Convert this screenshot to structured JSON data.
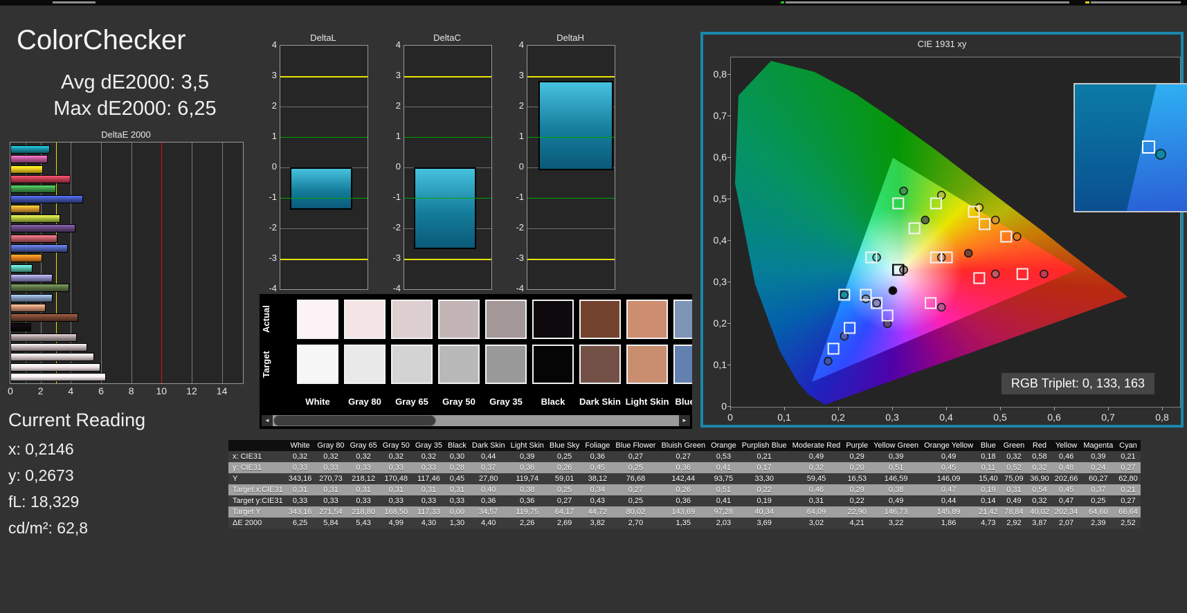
{
  "summary": {
    "title": "ColorChecker",
    "avg": "Avg dE2000: 3,5",
    "max": "Max dE2000: 6,25"
  },
  "deltae_chart": {
    "title": "DeltaE 2000",
    "x_ticks": [
      0,
      2,
      4,
      6,
      8,
      10,
      12,
      14
    ],
    "x_max": 15.3,
    "guide_colors": {
      "green": "#00a400",
      "yellow": "#e4e400",
      "red": "#e01010"
    },
    "guides": {
      "green": 1,
      "yellow": 3,
      "red": 10
    }
  },
  "delta_bars": {
    "titles": [
      "DeltaL",
      "DeltaC",
      "DeltaH"
    ],
    "values": [
      -1.3,
      -2.6,
      2.85
    ],
    "y_ticks": [
      4,
      3,
      2,
      1,
      0,
      -1,
      -2,
      -3,
      -4
    ],
    "green_guides": [
      1,
      -1
    ],
    "yellow_guides": [
      3,
      -3
    ]
  },
  "swatch_panel": {
    "row_labels": [
      "Actual",
      "Target"
    ],
    "scrollbar": {
      "left_arrow": "◄",
      "right_arrow": "►"
    }
  },
  "cie": {
    "title": "CIE 1931 xy",
    "rgb_triplet": "RGB Triplet: 0, 133, 163",
    "x_ticks": [
      "0",
      "0,1",
      "0,2",
      "0,3",
      "0,4",
      "0,5",
      "0,6",
      "0,7",
      "0,8"
    ],
    "y_ticks": [
      "0",
      "0,1",
      "0,2",
      "0,3",
      "0,4",
      "0,5",
      "0,6",
      "0,7",
      "0,8"
    ],
    "accent": "#1b87ab"
  },
  "current_reading": {
    "title": "Current Reading",
    "lines": [
      "x: 0,2146",
      "y: 0,2673",
      "fL: 18,329",
      "cd/m²: 62,8"
    ]
  },
  "table": {
    "row_labels": [
      "x: CIE31",
      "y: CIE31",
      "Y",
      "Target x:CIE31",
      "Target y:CIE31",
      "Target Y",
      "ΔE 2000"
    ]
  },
  "patches": [
    {
      "name": "White",
      "actual_color": "#fdf3f6",
      "target_color": "#f7f7f7",
      "x": "0,32",
      "y": "0,33",
      "Y": "343,16",
      "tx": "0,31",
      "ty": "0,33",
      "tY": "343,16",
      "dE": "6,25"
    },
    {
      "name": "Gray 80",
      "actual_color": "#f3e5e6",
      "target_color": "#e9e9e9",
      "x": "0,32",
      "y": "0,33",
      "Y": "270,73",
      "tx": "0,31",
      "ty": "0,33",
      "tY": "271,54",
      "dE": "5,84"
    },
    {
      "name": "Gray 65",
      "actual_color": "#ddcecf",
      "target_color": "#d3d3d3",
      "x": "0,32",
      "y": "0,33",
      "Y": "218,12",
      "tx": "0,31",
      "ty": "0,33",
      "tY": "218,80",
      "dE": "5,43"
    },
    {
      "name": "Gray 50",
      "actual_color": "#c3b5b6",
      "target_color": "#b9b9b9",
      "x": "0,32",
      "y": "0,33",
      "Y": "170,48",
      "tx": "0,31",
      "ty": "0,33",
      "tY": "168,50",
      "dE": "4,99"
    },
    {
      "name": "Gray 35",
      "actual_color": "#a49798",
      "target_color": "#999999",
      "x": "0,32",
      "y": "0,33",
      "Y": "117,46",
      "tx": "0,31",
      "ty": "0,33",
      "tY": "117,33",
      "dE": "4,30"
    },
    {
      "name": "Black",
      "actual_color": "#0d090c",
      "target_color": "#050505",
      "x": "0,30",
      "y": "0,28",
      "Y": "0,45",
      "tx": "0,31",
      "ty": "0,33",
      "tY": "0,00",
      "dE": "1,30"
    },
    {
      "name": "Dark Skin",
      "actual_color": "#744330",
      "target_color": "#735046",
      "x": "0,44",
      "y": "0,37",
      "Y": "27,80",
      "tx": "0,40",
      "ty": "0,36",
      "tY": "34,57",
      "dE": "4,40"
    },
    {
      "name": "Light Skin",
      "actual_color": "#cd8d6f",
      "target_color": "#c98d6f",
      "x": "0,39",
      "y": "0,36",
      "Y": "119,74",
      "tx": "0,38",
      "ty": "0,36",
      "tY": "119,75",
      "dE": "2,26"
    },
    {
      "name": "Blue Sky",
      "actual_color": "#7e95b8",
      "target_color": "#6280b0",
      "x": "0,25",
      "y": "0,26",
      "Y": "59,01",
      "tx": "0,25",
      "ty": "0,27",
      "tY": "64,17",
      "dE": "2,69"
    },
    {
      "name": "Foliage",
      "actual_color": "#5a7144",
      "target_color": "#576c43",
      "x": "0,36",
      "y": "0,45",
      "Y": "38,12",
      "tx": "0,34",
      "ty": "0,43",
      "tY": "44,72",
      "dE": "3,82"
    },
    {
      "name": "Blue Flower",
      "actual_color": "#8a87bd",
      "target_color": "#8580b1",
      "x": "0,27",
      "y": "0,25",
      "Y": "76,68",
      "tx": "0,27",
      "ty": "0,25",
      "tY": "80,02",
      "dE": "2,70"
    },
    {
      "name": "Bluish Green",
      "actual_color": "#55c0ab",
      "target_color": "#67bdaa",
      "x": "0,27",
      "y": "0,36",
      "Y": "142,44",
      "tx": "0,26",
      "ty": "0,36",
      "tY": "143,69",
      "dE": "1,35"
    },
    {
      "name": "Orange",
      "actual_color": "#e07d1f",
      "target_color": "#d67e2c",
      "x": "0,53",
      "y": "0,41",
      "Y": "93,75",
      "tx": "0,51",
      "ty": "0,41",
      "tY": "97,28",
      "dE": "2,03"
    },
    {
      "name": "Purplish Blue",
      "actual_color": "#4f61b5",
      "target_color": "#505ba6",
      "x": "0,21",
      "y": "0,17",
      "Y": "33,30",
      "tx": "0,22",
      "ty": "0,19",
      "tY": "40,34",
      "dE": "3,69"
    },
    {
      "name": "Moderate Red",
      "actual_color": "#c05a66",
      "target_color": "#c15a63",
      "x": "0,49",
      "y": "0,32",
      "Y": "59,45",
      "tx": "0,46",
      "ty": "0,31",
      "tY": "64,09",
      "dE": "3,02"
    },
    {
      "name": "Purple",
      "actual_color": "#63477d",
      "target_color": "#5e3c6c",
      "x": "0,29",
      "y": "0,20",
      "Y": "16,53",
      "tx": "0,29",
      "ty": "0,22",
      "tY": "22,90",
      "dE": "4,21"
    },
    {
      "name": "Yellow Green",
      "actual_color": "#adc13d",
      "target_color": "#9dbc40",
      "x": "0,39",
      "y": "0,51",
      "Y": "146,59",
      "tx": "0,38",
      "ty": "0,49",
      "tY": "146,73",
      "dE": "3,22"
    },
    {
      "name": "Orange Yellow",
      "actual_color": "#d8992d",
      "target_color": "#e0a32e",
      "x": "0,49",
      "y": "0,45",
      "Y": "146,09",
      "tx": "0,47",
      "ty": "0,44",
      "tY": "145,89",
      "dE": "1,86"
    },
    {
      "name": "Blue",
      "actual_color": "#3e51ad",
      "target_color": "#383d96",
      "x": "0,18",
      "y": "0,11",
      "Y": "15,40",
      "tx": "0,19",
      "ty": "0,14",
      "tY": "21,42",
      "dE": "4,73"
    },
    {
      "name": "Green",
      "actual_color": "#3f9a4a",
      "target_color": "#469449",
      "x": "0,32",
      "y": "0,52",
      "Y": "75,09",
      "tx": "0,31",
      "ty": "0,49",
      "tY": "78,84",
      "dE": "2,92"
    },
    {
      "name": "Red",
      "actual_color": "#c23b50",
      "target_color": "#af363c",
      "x": "0,58",
      "y": "0,32",
      "Y": "36,90",
      "tx": "0,54",
      "ty": "0,32",
      "tY": "40,02",
      "dE": "3,87"
    },
    {
      "name": "Yellow",
      "actual_color": "#e7c720",
      "target_color": "#e7c71f",
      "x": "0,46",
      "y": "0,48",
      "Y": "202,66",
      "tx": "0,45",
      "ty": "0,47",
      "tY": "202,34",
      "dE": "2,07"
    },
    {
      "name": "Magenta",
      "actual_color": "#bb5695",
      "target_color": "#b85f92",
      "x": "0,39",
      "y": "0,24",
      "Y": "60,27",
      "tx": "0,37",
      "ty": "0,25",
      "tY": "64,60",
      "dE": "2,39"
    },
    {
      "name": "Cyan",
      "actual_color": "#1a8fa0",
      "target_color": "#0885a1",
      "x": "0,21",
      "y": "0,27",
      "Y": "62,80",
      "tx": "0,21",
      "ty": "0,27",
      "tY": "66,64",
      "dE": "2,52"
    }
  ]
}
